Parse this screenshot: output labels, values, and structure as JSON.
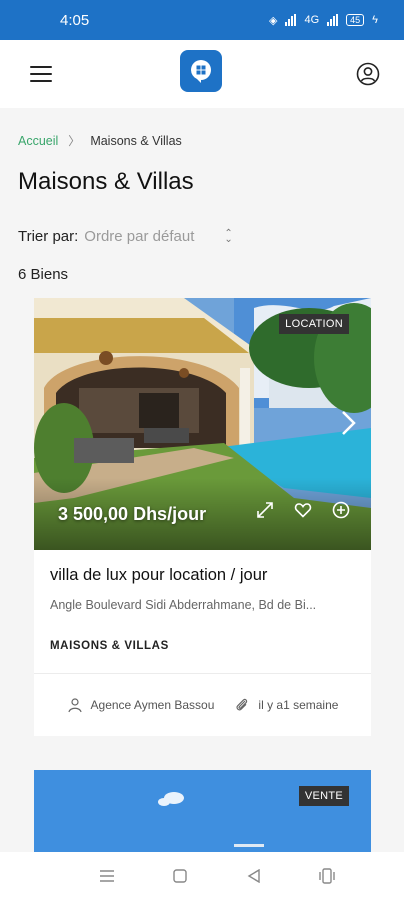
{
  "status_bar": {
    "time": "4:05",
    "network_label": "4G",
    "battery": "45"
  },
  "header": {
    "menu_icon": "menu-icon",
    "logo_icon": "location-pin-logo",
    "user_icon": "user-icon"
  },
  "breadcrumb": {
    "home": "Accueil",
    "current": "Maisons & Villas"
  },
  "page": {
    "title": "Maisons & Villas",
    "sort_label": "Trier par:",
    "sort_value": "Ordre par défaut",
    "count": "6 Biens"
  },
  "listings": [
    {
      "badge": "LOCATION",
      "price": "3 500,00 Dhs/jour",
      "title": "villa de lux pour location / jour",
      "address": "Angle Boulevard Sidi Abderrahmane, Bd de Bi...",
      "type": "MAISONS & VILLAS",
      "agent": "Agence Aymen Bassou",
      "posted": "il y a1 semaine"
    },
    {
      "badge": "VENTE"
    }
  ],
  "colors": {
    "primary": "#1e72c6",
    "breadcrumb_link": "#3aa66c",
    "badge_bg": "#333333"
  }
}
